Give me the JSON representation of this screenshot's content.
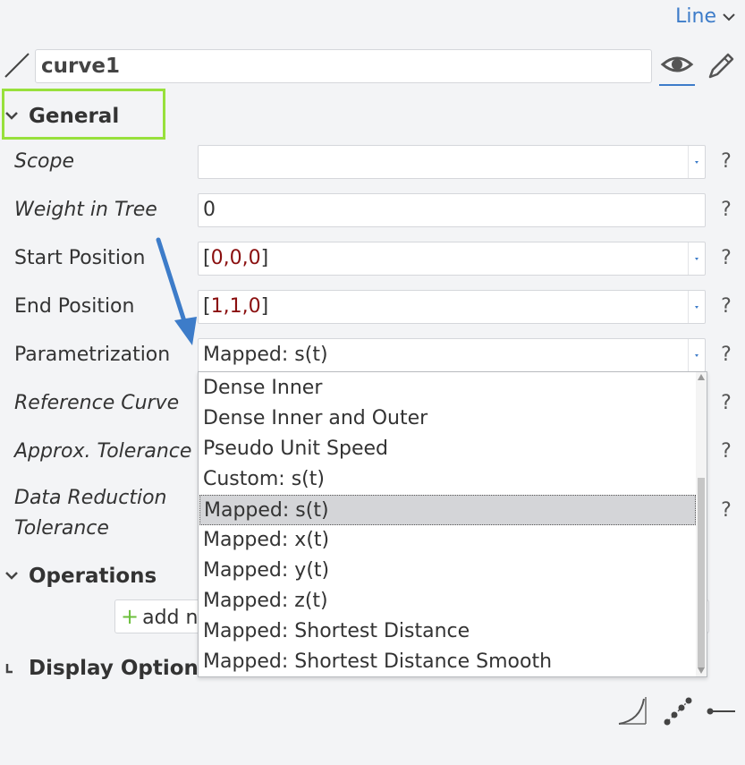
{
  "header": {
    "type_label": "Line",
    "object_name": "curve1"
  },
  "sections": {
    "general": "General",
    "operations": "Operations",
    "display_options": "Display Options"
  },
  "properties": [
    {
      "label": "Scope",
      "value": ""
    },
    {
      "label": "Weight in Tree",
      "value": "0"
    },
    {
      "label": "Start Position",
      "value": "0,0,0"
    },
    {
      "label": "End Position",
      "value": "1,1,0"
    },
    {
      "label": "Parametrization",
      "value": "Mapped: s(t)"
    },
    {
      "label": "Reference Curve",
      "value": ""
    },
    {
      "label": "Approx. Tolerance",
      "value": ""
    },
    {
      "label": "Data Reduction",
      "value": ""
    },
    {
      "label": "Tolerance",
      "value": ""
    }
  ],
  "help_label": "?",
  "add_button_label": "add n",
  "dropdown": {
    "options": [
      "Dense Inner",
      "Dense Inner and Outer",
      "Pseudo Unit Speed",
      "Custom: s(t)",
      "Mapped: s(t)",
      "Mapped: x(t)",
      "Mapped: y(t)",
      "Mapped: z(t)",
      "Mapped: Shortest Distance",
      "Mapped: Shortest Distance Smooth"
    ],
    "selected_index": 4
  },
  "colors": {
    "accent": "#3d7cc9",
    "highlight_box": "#98e03c",
    "value_red": "#8a0f0f",
    "add_plus": "#6cbf3c"
  },
  "icons": [
    "chevron-down-icon",
    "line-icon",
    "eye-icon",
    "pencil-icon",
    "plus-icon",
    "curve-icon",
    "points-icon",
    "line-end-icon"
  ]
}
